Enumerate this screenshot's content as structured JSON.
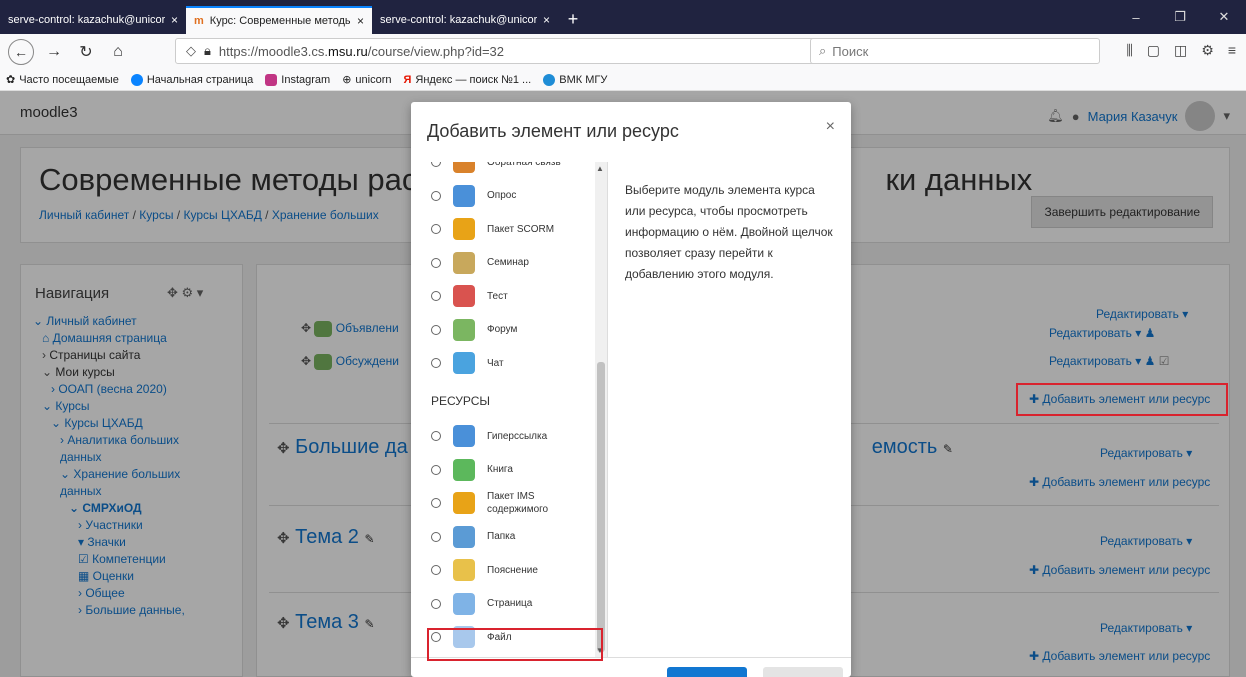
{
  "browser": {
    "tabs": [
      {
        "title": "serve-control: kazachuk@unicorn.e",
        "close": "×"
      },
      {
        "title": "Курс: Современные методы р",
        "close": "×"
      },
      {
        "title": "serve-control: kazachuk@unicorn.e",
        "close": "×"
      }
    ],
    "new_tab": "+",
    "url_prefix": "https://moodle3.cs.",
    "url_host": "msu.ru",
    "url_path": "/course/view.php?id=32",
    "url_dots": "···",
    "search_placeholder": "Поиск",
    "bookmarks": [
      {
        "label": "Часто посещаемые",
        "color": "#999999"
      },
      {
        "label": "Начальная страница",
        "color": "#0a84ff"
      },
      {
        "label": "Instagram",
        "color": "#c13584"
      },
      {
        "label": "unicorn",
        "color": "#444444"
      },
      {
        "label": "Яндекс — поиск №1 ...",
        "color": "#e61400"
      },
      {
        "label": "ВМК МГУ",
        "color": "#1f8dd6"
      }
    ]
  },
  "moodle": {
    "brand": "moodle3",
    "user_name": "Мария Казачук",
    "course_title_left": "Современные методы распр",
    "course_title_right": "ки данных",
    "breadcrumbs": [
      "Личный кабинет",
      "Курсы",
      "Курсы ЦХАБД",
      "Хранение больших"
    ],
    "end_editing": "Завершить редактирование",
    "nav_title": "Навигация",
    "nav_items": [
      {
        "text": "Личный кабинет",
        "indent": 0,
        "style": "link",
        "prefix": "⌄"
      },
      {
        "text": "Домашняя страница",
        "indent": 1,
        "style": "link",
        "prefix": "⌂"
      },
      {
        "text": "Страницы сайта",
        "indent": 1,
        "style": "plain",
        "prefix": "›"
      },
      {
        "text": "Мои курсы",
        "indent": 1,
        "style": "plain",
        "prefix": "⌄"
      },
      {
        "text": "ООАП (весна 2020)",
        "indent": 2,
        "style": "link",
        "prefix": "›"
      },
      {
        "text": "Курсы",
        "indent": 1,
        "style": "link",
        "prefix": "⌄"
      },
      {
        "text": "Курсы ЦХАБД",
        "indent": 2,
        "style": "link",
        "prefix": "⌄"
      },
      {
        "text": "Аналитика больших",
        "indent": 3,
        "style": "link",
        "prefix": "›"
      },
      {
        "text": "данных",
        "indent": 3,
        "style": "link",
        "prefix": ""
      },
      {
        "text": "Хранение больших",
        "indent": 3,
        "style": "link",
        "prefix": "⌄"
      },
      {
        "text": "данных",
        "indent": 3,
        "style": "link",
        "prefix": ""
      },
      {
        "text": "СМРХиОД",
        "indent": 4,
        "style": "cur",
        "prefix": "⌄"
      },
      {
        "text": "Участники",
        "indent": 5,
        "style": "link",
        "prefix": "›"
      },
      {
        "text": "Значки",
        "indent": 5,
        "style": "link",
        "prefix": "▾"
      },
      {
        "text": "Компетенции",
        "indent": 5,
        "style": "link",
        "prefix": "☑"
      },
      {
        "text": "Оценки",
        "indent": 5,
        "style": "link",
        "prefix": "▦"
      },
      {
        "text": "Общее",
        "indent": 5,
        "style": "link",
        "prefix": "›"
      },
      {
        "text": "Большие данные,",
        "indent": 5,
        "style": "link",
        "prefix": "›"
      }
    ],
    "news_forum": "Объявлени",
    "discussion_forum": "Обсуждени",
    "section1": "Большие да",
    "section1_tail": "емость",
    "section2": "Тема 2",
    "section3": "Тема 3",
    "edit_label": "Редактировать",
    "add_label": "Добавить элемент или ресурс"
  },
  "modal": {
    "title": "Добавить элемент или ресурс",
    "close": "×",
    "activities": [
      {
        "label": "Обратная связь",
        "color": "#d9822b"
      },
      {
        "label": "Опрос",
        "color": "#4a90d9"
      },
      {
        "label": "Пакет SCORM",
        "color": "#e8a317"
      },
      {
        "label": "Семинар",
        "color": "#c8a85c"
      },
      {
        "label": "Тест",
        "color": "#d9534f"
      },
      {
        "label": "Форум",
        "color": "#7bb661"
      },
      {
        "label": "Чат",
        "color": "#4aa3df"
      }
    ],
    "resources_heading": "РЕСУРСЫ",
    "resources": [
      {
        "label": "Гиперссылка",
        "color": "#4a90d9"
      },
      {
        "label": "Книга",
        "color": "#5cb85c"
      },
      {
        "label": "Пакет IMS",
        "label2": "содержимого",
        "color": "#e8a317"
      },
      {
        "label": "Папка",
        "color": "#5b9bd5"
      },
      {
        "label": "Пояснение",
        "color": "#e8c14a"
      },
      {
        "label": "Страница",
        "color": "#7fb3e6"
      },
      {
        "label": "Файл",
        "color": "#a8c8ec"
      }
    ],
    "description": "Выберите модуль элемента курса или ресурса, чтобы просмотреть информацию о нём. Двойной щелчок позволяет сразу перейти к добавлению этого модуля."
  }
}
